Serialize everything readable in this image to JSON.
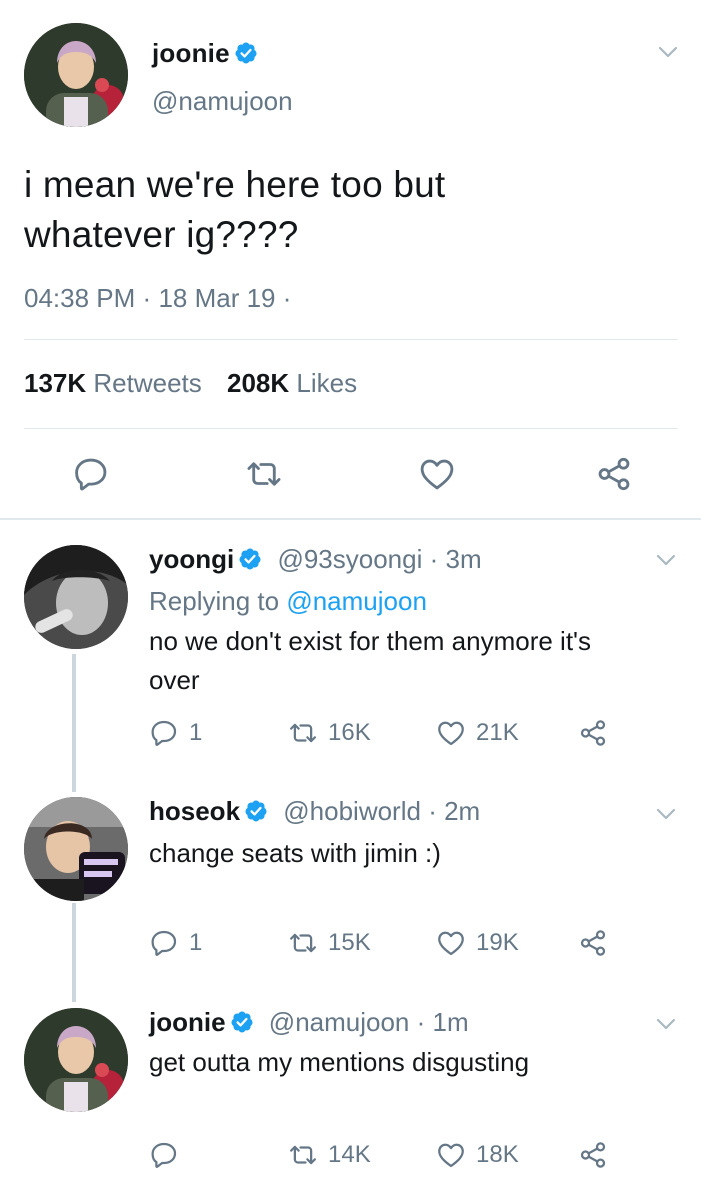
{
  "main_tweet": {
    "display_name": "joonie",
    "handle": "@namujoon",
    "text_line1": "i mean we're here too but",
    "text_line2": "whatever ig????",
    "time": "04:38 PM",
    "date": "18 Mar 19",
    "retweets_count": "137K",
    "retweets_label": "Retweets",
    "likes_count": "208K",
    "likes_label": "Likes"
  },
  "replies": [
    {
      "display_name": "yoongi",
      "handle": "@93syoongi",
      "time": "3m",
      "replying_prefix": "Replying to",
      "replying_to": "@namujoon",
      "text_line1": "no we don't exist for them anymore it's",
      "text_line2": "over",
      "reply_count": "1",
      "retweet_count": "16K",
      "like_count": "21K"
    },
    {
      "display_name": "hoseok",
      "handle": "@hobiworld",
      "time": "2m",
      "text_line1": "change seats with jimin :)",
      "reply_count": "1",
      "retweet_count": "15K",
      "like_count": "19K"
    },
    {
      "display_name": "joonie",
      "handle": "@namujoon",
      "time": "1m",
      "text_line1": "get outta my mentions disgusting",
      "reply_count": "",
      "retweet_count": "14K",
      "like_count": "18K"
    }
  ],
  "separator": "·",
  "colors": {
    "accent": "#1da1f2",
    "muted": "#657786",
    "divider": "#e1e8ed",
    "thread": "#ccd6dd"
  }
}
